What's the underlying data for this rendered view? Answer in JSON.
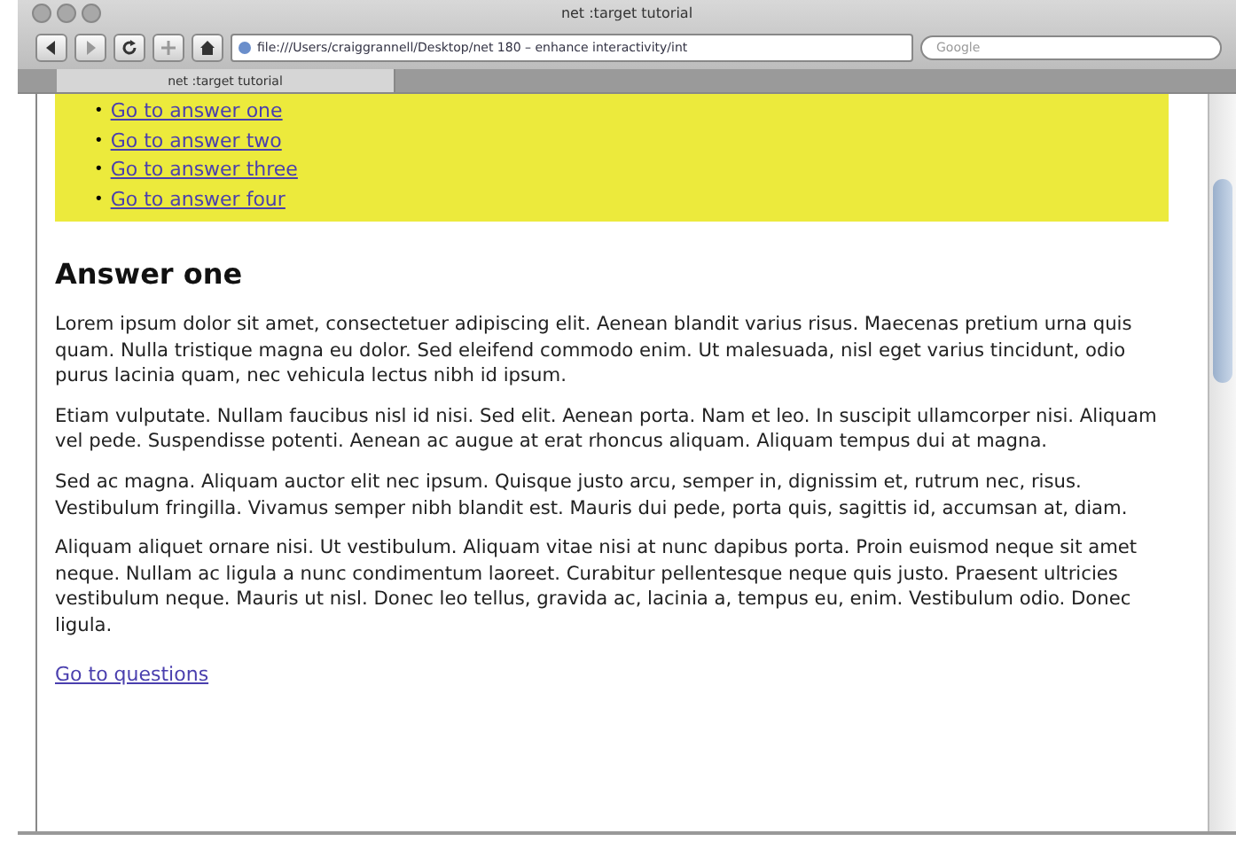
{
  "window": {
    "title": "net :target tutorial"
  },
  "toolbar": {
    "address": "file:///Users/craiggrannell/Desktop/net 180 – enhance interactivity/int",
    "search": {
      "placeholder": "Google"
    }
  },
  "tabs": [
    {
      "label": "net :target tutorial",
      "selected": true
    }
  ],
  "nav_links": [
    {
      "marker": "•",
      "label": "Go to answer one"
    },
    {
      "marker": "•",
      "label": "Go to answer two"
    },
    {
      "marker": "•",
      "label": "Go to answer three"
    },
    {
      "marker": "•",
      "label": "Go to answer four"
    }
  ],
  "heading": "Answer one",
  "paragraphs": [
    "Lorem ipsum dolor sit amet, consectetuer adipiscing elit. Aenean blandit varius risus. Maecenas pretium urna quis quam. Nulla tristique magna eu dolor. Sed eleifend commodo enim. Ut malesuada, nisl eget varius tincidunt, odio purus lacinia quam, nec vehicula lectus nibh id ipsum.",
    "Etiam vulputate. Nullam faucibus nisl id nisi. Sed elit. Aenean porta. Nam et leo. In suscipit ullamcorper nisi. Aliquam vel pede. Suspendisse potenti. Aenean ac augue at erat rhoncus aliquam. Aliquam tempus dui at magna.",
    "Sed ac magna. Aliquam auctor elit nec ipsum. Quisque justo arcu, semper in, dignissim et, rutrum nec, risus. Vestibulum fringilla. Vivamus semper nibh blandit est. Mauris dui pede, porta quis, sagittis id, accumsan at, diam.",
    "Aliquam aliquet ornare nisi. Ut vestibulum. Aliquam vitae nisi at nunc dapibus porta. Proin euismod neque sit amet neque. Nullam ac ligula a nunc condimentum laoreet. Curabitur pellentesque neque quis justo. Praesent ultricies vestibulum neque. Mauris ut nisl. Donec leo tellus, gravida ac, lacinia a, tempus eu, enim. Vestibulum odio. Donec ligula."
  ],
  "back_link": "Go to questions"
}
